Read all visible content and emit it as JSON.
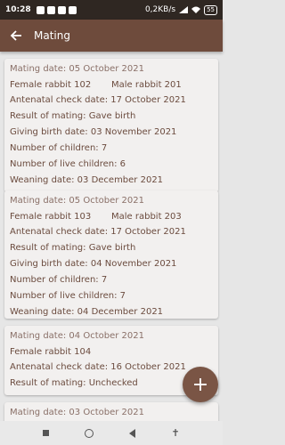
{
  "status_bar": {
    "time": "10:28",
    "speed": "0,2KB/s",
    "battery": "55"
  },
  "app_bar": {
    "title": "Mating"
  },
  "records": [
    {
      "mating_date": "Mating date: 05 October 2021",
      "female": "Female rabbit 102",
      "male": "Male rabbit 201",
      "antenatal": "Antenatal check date: 17 October 2021",
      "result": "Result of mating: Gave birth",
      "giving_birth": "Giving birth date: 03 November 2021",
      "children": "Number of children: 7",
      "live_children": "Number of live children: 6",
      "weaning": "Weaning date: 03 December 2021"
    },
    {
      "mating_date": "Mating date: 05 October 2021",
      "female": "Female rabbit 103",
      "male": "Male rabbit 203",
      "antenatal": "Antenatal check date: 17 October 2021",
      "result": "Result of mating: Gave birth",
      "giving_birth": "Giving birth date: 04 November 2021",
      "children": "Number of children: 7",
      "live_children": "Number of live children: 7",
      "weaning": "Weaning date: 04 December 2021"
    },
    {
      "mating_date": "Mating date: 04 October 2021",
      "female": "Female rabbit 104",
      "antenatal": "Antenatal check date: 16 October 2021",
      "result": "Result of mating: Unchecked"
    },
    {
      "mating_date": "Mating date: 03 October 2021"
    }
  ],
  "fab": {
    "label": "+"
  },
  "colors": {
    "app_bar": "#6e4b3c",
    "status_bar": "#2f2722",
    "text": "#6b4b3e",
    "fab": "#7a5545"
  },
  "icons": {
    "back": "arrow-left-icon",
    "fab": "plus-icon"
  }
}
